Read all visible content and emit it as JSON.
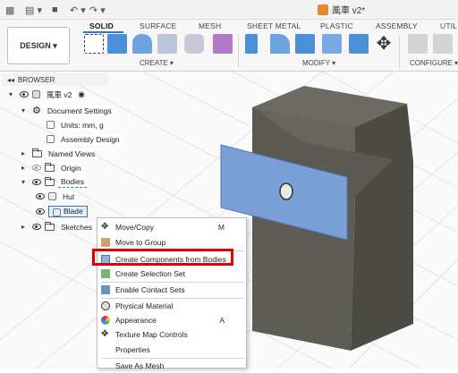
{
  "appbar": {
    "title": "風車 v2*"
  },
  "ribbon": {
    "workspace": "DESIGN",
    "tabs": [
      "SOLID",
      "SURFACE",
      "MESH",
      "SHEET METAL",
      "PLASTIC",
      "ASSEMBLY",
      "UTIL"
    ],
    "active_tab": "SOLID",
    "groups": [
      "CREATE",
      "MODIFY",
      "CONFIGURE"
    ]
  },
  "browser": {
    "title": "BROWSER",
    "root": "風車 v2",
    "items": [
      "Document Settings",
      "Units: mm, g",
      "Assembly Design",
      "Named Views",
      "Origin",
      "Bodies",
      "Hut",
      "Blade",
      "Sketches"
    ]
  },
  "menu": {
    "items": [
      {
        "label": "Move/Copy",
        "shortcut": "M"
      },
      {
        "label": "Move to Group",
        "shortcut": ""
      },
      {
        "label": "Create Components from Bodies",
        "shortcut": ""
      },
      {
        "label": "Create Selection Set",
        "shortcut": ""
      },
      {
        "label": "Enable Contact Sets",
        "shortcut": ""
      },
      {
        "label": "Physical Material",
        "shortcut": ""
      },
      {
        "label": "Appearance",
        "shortcut": "A"
      },
      {
        "label": "Texture Map Controls",
        "shortcut": ""
      },
      {
        "label": "Properties",
        "shortcut": ""
      },
      {
        "label": "Save As Mesh",
        "shortcut": ""
      }
    ]
  },
  "colors": {
    "accent": "#2f78c4",
    "highlight": "#e00000",
    "body": "#5a5a52",
    "blade": "#7a9fd6"
  }
}
